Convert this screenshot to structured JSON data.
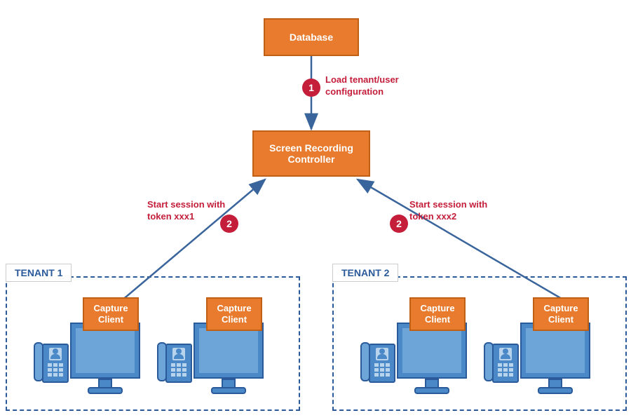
{
  "nodes": {
    "database": "Database",
    "controller": "Screen Recording Controller",
    "capture": "Capture Client"
  },
  "tenants": {
    "t1": "TENANT 1",
    "t2": "TENANT 2"
  },
  "steps": {
    "s1": {
      "num": "1",
      "text": "Load tenant/user configuration"
    },
    "s2a": {
      "num": "2",
      "text": "Start session with token xxx1"
    },
    "s2b": {
      "num": "2",
      "text": "Start session with token xxx2"
    }
  },
  "colors": {
    "node_fill": "#e87b2e",
    "node_border": "#c05f16",
    "tenant_border": "#2a5a9a",
    "badge": "#c41e3a",
    "arrow": "#3a659c"
  }
}
